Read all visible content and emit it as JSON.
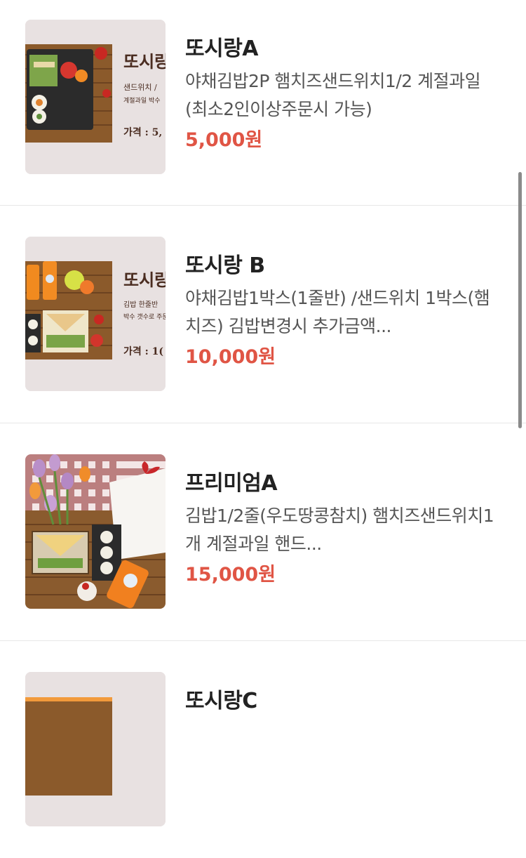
{
  "items": [
    {
      "name": "또시랑A",
      "description": "야채김밥2P 햄치즈샌드위치1/2 계절과일 (최소2인이상주문시 가능)",
      "price": "5,000원",
      "thumb_title": "또시랑",
      "thumb_line1": "샌드위치 /",
      "thumb_line2": "계절과일 박수",
      "thumb_price": "가격 : 5,",
      "thumb_icon": "bento-photo-icon"
    },
    {
      "name": "또시랑 B",
      "description": "야채김밥1박스(1줄반) /샌드위치 1박스(햄치즈) 김밥변경시 추가금액...",
      "price": "10,000원",
      "thumb_title": "또시랑",
      "thumb_line1": "김밥 한줄반",
      "thumb_line2": "박수 갯수로 주문",
      "thumb_price": "가격 : 1(",
      "thumb_icon": "bento-photo-icon"
    },
    {
      "name": "프리미엄A",
      "description": "김밥1/2줄(우도땅콩참치) 햄치즈샌드위치1개 계절과일 핸드...",
      "price": "15,000원",
      "thumb_icon": "picnic-photo-icon"
    },
    {
      "name": "또시랑C",
      "thumb_icon": "bento-photo-icon"
    }
  ],
  "colors": {
    "price": "#e05545",
    "name": "#222222",
    "description": "#555555",
    "divider": "#e7e7e7"
  }
}
